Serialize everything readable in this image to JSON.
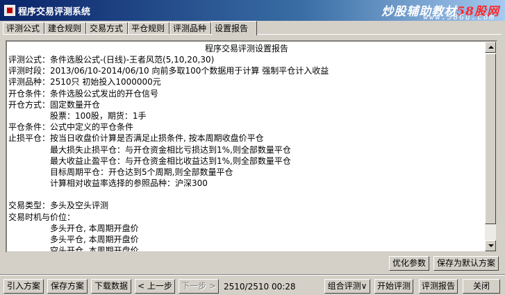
{
  "window": {
    "title": "程序交易评测系统",
    "watermark_main": "炒股辅助教材",
    "watermark_brand": "58股网",
    "watermark_url": "www.58Gu.com"
  },
  "tabs": [
    {
      "label": "评测公式",
      "active": false
    },
    {
      "label": "建仓规则",
      "active": false
    },
    {
      "label": "交易方式",
      "active": false
    },
    {
      "label": "平仓规则",
      "active": false
    },
    {
      "label": "评测品种",
      "active": false
    },
    {
      "label": "设置报告",
      "active": true
    }
  ],
  "report": {
    "title": "程序交易评测设置报告",
    "lines": [
      "评测公式：条件选股公式-(日线)-王者风范(5,10,20,30)",
      "评测时段：2013/06/10-2014/06/10 向前多取100个数据用于计算 强制平仓计入收益",
      "评测品种：2510只 初始投入1000000元",
      "开仓条件：条件选股公式发出的开仓信号",
      "开仓方式：固定数量开仓",
      "股票：100股，期货：1手",
      "平仓条件：公式中定义的平仓条件",
      "止损平仓：按当日收盘价计算是否满足止损条件, 按本周期收盘价平仓",
      "最大损失止损平仓：与开仓资金相比亏损达到1%,则全部数量平仓",
      "最大收益止盈平仓：与开仓资金相比收益达到1%,则全部数量平仓",
      "目标周期平仓：开仓达到5个周期,则全部数量平仓",
      "计算相对收益率选择的参照品种：沪深300",
      "",
      "交易类型：多头及空头评测",
      "交易时机与价位：",
      "多头开仓, 本周期开盘价",
      "多头平仓, 本周期开盘价",
      "空头开仓, 本周期开盘价"
    ]
  },
  "buttons": {
    "optimize": "优化参数",
    "save_default": "保存为默认方案",
    "import": "引入方案",
    "save": "保存方案",
    "download": "下载数据",
    "prev": "< 上一步",
    "next": "下一步 >",
    "combo": "组合评测∨",
    "start": "开始评测",
    "report": "评测报告",
    "close": "关闭"
  },
  "status": {
    "progress": "2510/2510",
    "time": "00:28"
  }
}
